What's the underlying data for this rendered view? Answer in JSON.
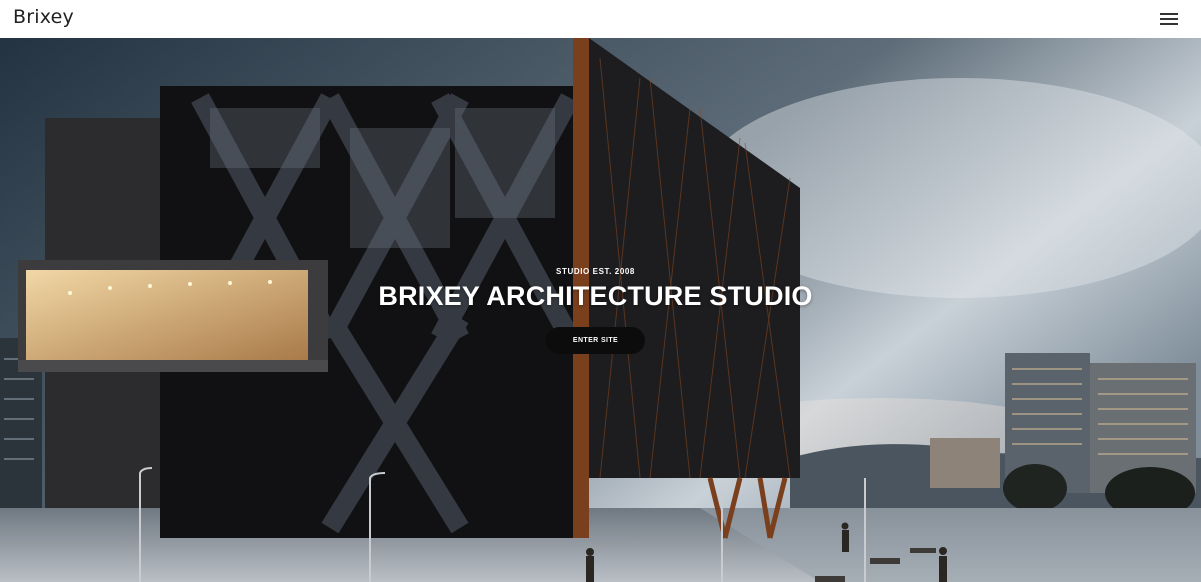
{
  "header": {
    "logo": "Brixey",
    "menu_icon": "hamburger-icon"
  },
  "hero": {
    "eyebrow": "STUDIO EST. 2008",
    "title": "BRIXEY ARCHITECTURE STUDIO",
    "cta_label": "ENTER SITE",
    "image_description_icon": "architecture-photo",
    "colors": {
      "sky_dark": "#27333f",
      "sky_light": "#cfd6dc",
      "building": "#1a1a1c",
      "wood": "#8a4a22",
      "window_glow": "#e8c890",
      "button": "#0c0c0c"
    }
  }
}
